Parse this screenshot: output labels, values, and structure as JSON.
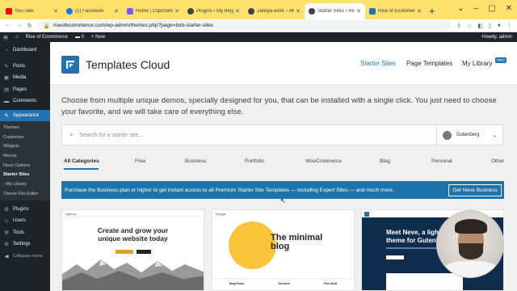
{
  "browser": {
    "tabs": [
      {
        "label": "YouTube",
        "color": "#ff0000"
      },
      {
        "label": "(1) Facebook",
        "color": "#1877f2"
      },
      {
        "label": "Home | Clipchamp",
        "color": "#7c5cff"
      },
      {
        "label": "Plugins ‹ My Blog —",
        "color": "#3c434a"
      },
      {
        "label": "Zeleiya work – My Bl",
        "color": "#3c434a"
      },
      {
        "label": "Starter Sites ‹ Rise of",
        "color": "#3c434a"
      },
      {
        "label": "Rise of Ecommerce",
        "color": "#2271b1"
      }
    ],
    "url": "riseofecommerce.com/wp-admin/themes.php?page=tiob-starter-sites"
  },
  "adminbar": {
    "site": "Rise of Ecommerce",
    "comments": "0",
    "new": "+ New",
    "howdy": "Howdy, admin"
  },
  "sidebar": {
    "items_top": [
      {
        "label": "Dashboard",
        "icon": "dashboard-icon",
        "glyph": "◔"
      },
      {
        "label": "Posts",
        "icon": "pin-icon",
        "glyph": "✎"
      },
      {
        "label": "Media",
        "icon": "media-icon",
        "glyph": "▣"
      },
      {
        "label": "Pages",
        "icon": "page-icon",
        "glyph": "▤"
      },
      {
        "label": "Comments",
        "icon": "comment-icon",
        "glyph": "▬"
      }
    ],
    "appearance": {
      "label": "Appearance",
      "icon": "brush-icon",
      "glyph": "✎"
    },
    "submenu": [
      "Themes",
      "Customize",
      "Widgets",
      "Menus",
      "Neve Options",
      "Starter Sites",
      "My Library",
      "Theme File Editor"
    ],
    "items_bottom": [
      {
        "label": "Plugins",
        "icon": "plugin-icon",
        "glyph": "⚙"
      },
      {
        "label": "Users",
        "icon": "user-icon",
        "glyph": "☺"
      },
      {
        "label": "Tools",
        "icon": "wrench-icon",
        "glyph": "⚒"
      },
      {
        "label": "Settings",
        "icon": "settings-icon",
        "glyph": "⚙"
      },
      {
        "label": "Collapse menu",
        "icon": "collapse-icon",
        "glyph": "◀"
      }
    ]
  },
  "header": {
    "title": "Templates Cloud",
    "nav": {
      "starter": "Starter Sites",
      "page_templates": "Page Templates",
      "library": "My Library",
      "pro": "PRO"
    }
  },
  "intro": "Choose from multiple unique demos, specially designed for you, that can be installed with a single click. You just need to choose your favorite, and we will take care of everything else.",
  "search": {
    "placeholder": "Search for a starter site...",
    "builder": "Gutenberg"
  },
  "categories": [
    "All Categories",
    "Free",
    "Business",
    "Portfolio",
    "WooCommerce",
    "Blog",
    "Personal",
    "Other"
  ],
  "notice": {
    "text": "Purchase the Business plan or higher to get instant access to all Premium Starter Site Templates — including Expert Sites — and much more.",
    "button": "Get Neve Business"
  },
  "cards": {
    "c1": {
      "brand": "Agency",
      "heading1": "Create and grow your",
      "heading2": "unique website today"
    },
    "c2": {
      "brand": "blogger",
      "heading1": "The minimal",
      "heading2": "blog",
      "footer": [
        "Blog Posts",
        "Services",
        "Free Stuff"
      ]
    },
    "c3": {
      "heading1": "Meet Neve, a lightwei",
      "heading2": "theme for Gutenberg"
    }
  }
}
